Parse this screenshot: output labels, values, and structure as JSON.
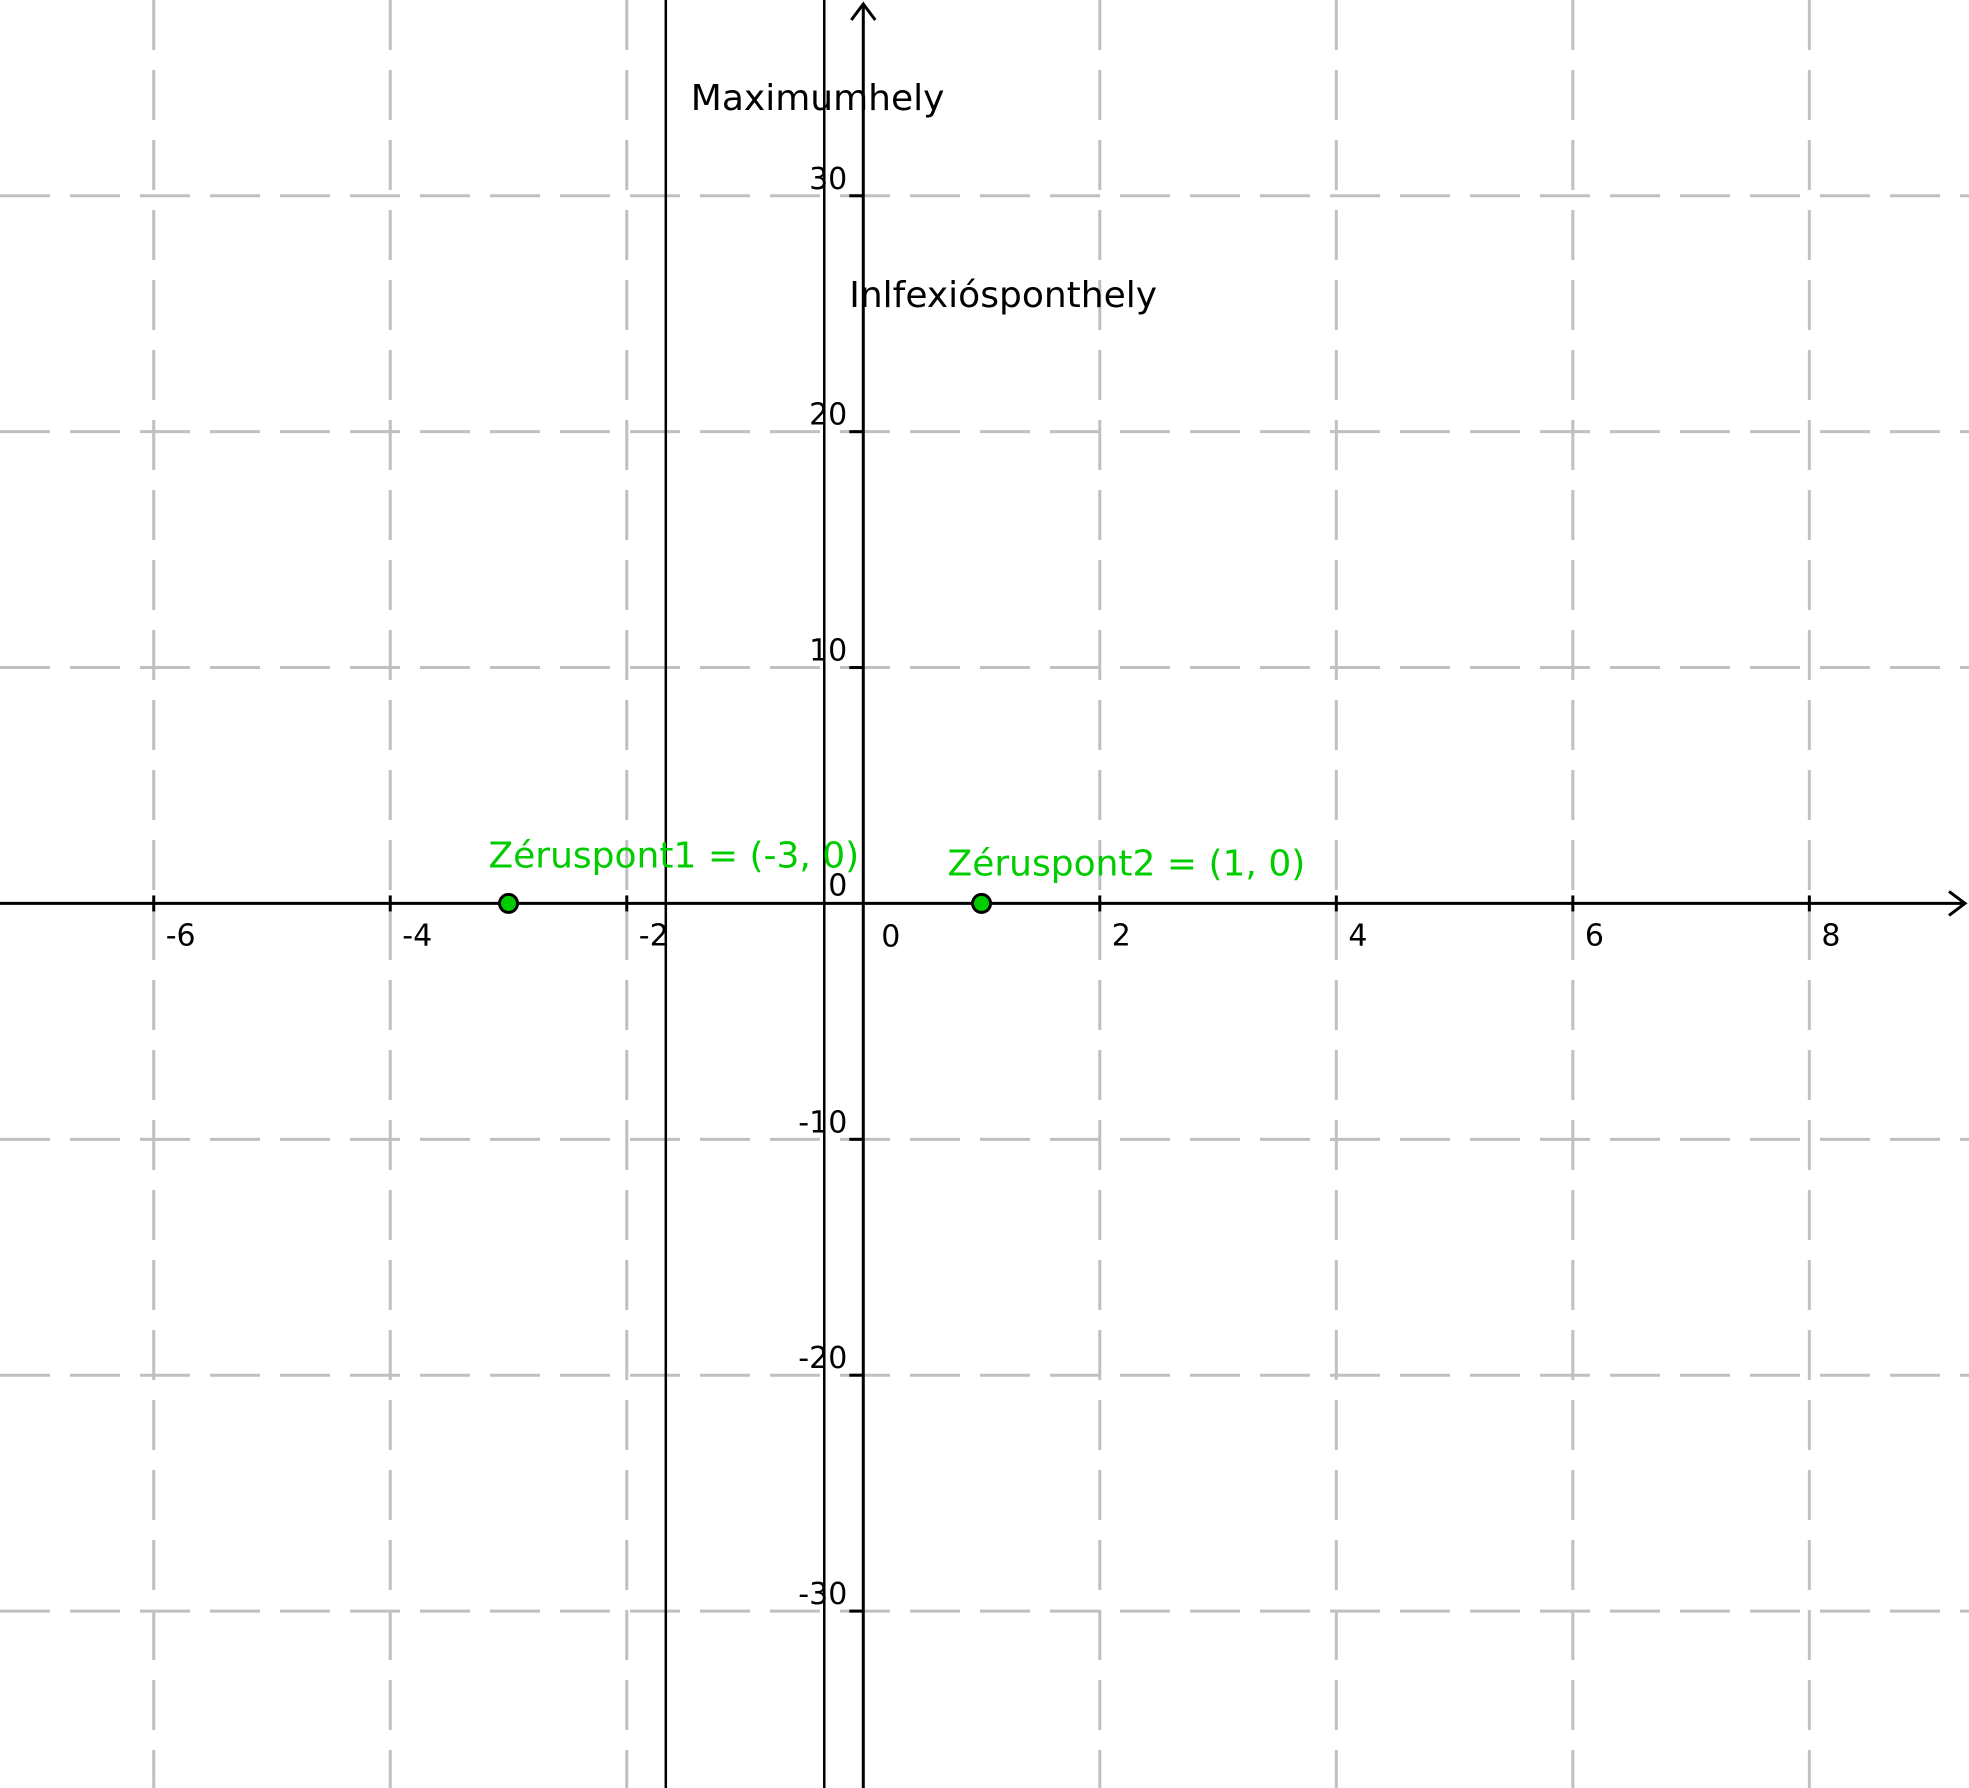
{
  "plot": {
    "x_range": [
      -7.3,
      9.35
    ],
    "y_range": [
      -37.5,
      38.3
    ],
    "x_ticks": [
      -6,
      -4,
      -2,
      2,
      4,
      6,
      8
    ],
    "y_ticks": [
      -30,
      -20,
      -10,
      10,
      20,
      30
    ],
    "origin_labels": [
      "0",
      "0"
    ],
    "grid": true,
    "colors": {
      "point": "#00cc00",
      "axis": "#000000",
      "grid": "#c0c0c0"
    }
  },
  "lines": [
    {
      "name": "Maximumhely",
      "x": -1.67
    },
    {
      "name": "Inlfexiósponthely",
      "x": -0.33
    }
  ],
  "points": [
    {
      "label": "Zéruspont1 = (-3, 0)",
      "x": -3,
      "y": 0
    },
    {
      "label": "Zéruspont2 = (1, 0)",
      "x": 1,
      "y": 0
    }
  ]
}
